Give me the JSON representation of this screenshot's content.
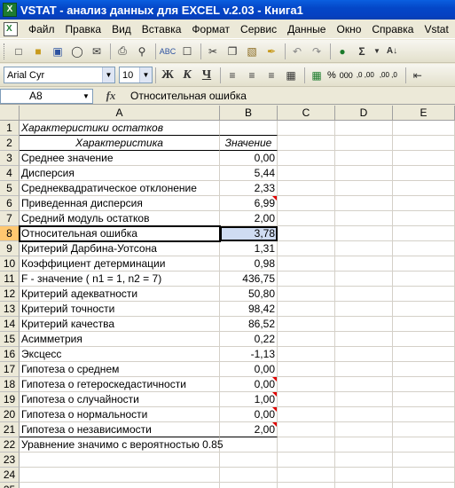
{
  "title": "VSTAT - анализ данных для EXCEL v.2.03 - Книга1",
  "menu": [
    "Файл",
    "Правка",
    "Вид",
    "Вставка",
    "Формат",
    "Сервис",
    "Данные",
    "Окно",
    "Справка",
    "Vstat"
  ],
  "toolbar2": {
    "font": "Arial Cyr",
    "size": "10",
    "bold": "Ж",
    "italic": "К",
    "underline": "Ч",
    "percent": "%",
    "thousands": "000",
    "inc_decimal": ",0 ,00",
    "dec_decimal": ",00 ,0"
  },
  "formula_bar": {
    "name_box": "A8",
    "fx": "fx",
    "content": "Относительная ошибка"
  },
  "columns": [
    "A",
    "B",
    "C",
    "D",
    "E"
  ],
  "rows": [
    {
      "n": "1",
      "a": "Характеристики остатков",
      "b": ""
    },
    {
      "n": "2",
      "a": "Характеристика",
      "b": "Значение"
    },
    {
      "n": "3",
      "a": "Среднее значение",
      "b": "0,00"
    },
    {
      "n": "4",
      "a": "Дисперсия",
      "b": "5,44"
    },
    {
      "n": "5",
      "a": "Среднеквадратическое отклонение",
      "b": "2,33"
    },
    {
      "n": "6",
      "a": "Приведенная дисперсия",
      "b": "6,99"
    },
    {
      "n": "7",
      "a": "Средний модуль остатков",
      "b": "2,00"
    },
    {
      "n": "8",
      "a": "Относительная ошибка",
      "b": "3,78"
    },
    {
      "n": "9",
      "a": "Критерий Дарбина-Уотсона",
      "b": "1,31"
    },
    {
      "n": "10",
      "a": "Коэффициент детерминации",
      "b": "0,98"
    },
    {
      "n": "11",
      "a": "F - значение ( n1 =   1, n2 =   7)",
      "b": "436,75"
    },
    {
      "n": "12",
      "a": "Критерий адекватности",
      "b": "50,80"
    },
    {
      "n": "13",
      "a": "Критерий точности",
      "b": "98,42"
    },
    {
      "n": "14",
      "a": "Критерий качества",
      "b": "86,52"
    },
    {
      "n": "15",
      "a": "Асимметрия",
      "b": "0,22"
    },
    {
      "n": "16",
      "a": "Эксцесс",
      "b": "-1,13"
    },
    {
      "n": "17",
      "a": "Гипотеза о среднем",
      "b": "0,00"
    },
    {
      "n": "18",
      "a": "Гипотеза о гетероскедастичности",
      "b": "0,00"
    },
    {
      "n": "19",
      "a": "Гипотеза о случайности",
      "b": "1,00"
    },
    {
      "n": "20",
      "a": "Гипотеза о нормальности",
      "b": "0,00"
    },
    {
      "n": "21",
      "a": "Гипотеза о независимости",
      "b": "2,00"
    },
    {
      "n": "22",
      "a": "Уравнение значимо с вероятностью 0.85",
      "b": ""
    },
    {
      "n": "23",
      "a": "",
      "b": ""
    },
    {
      "n": "24",
      "a": "",
      "b": ""
    },
    {
      "n": "25",
      "a": "",
      "b": ""
    }
  ]
}
